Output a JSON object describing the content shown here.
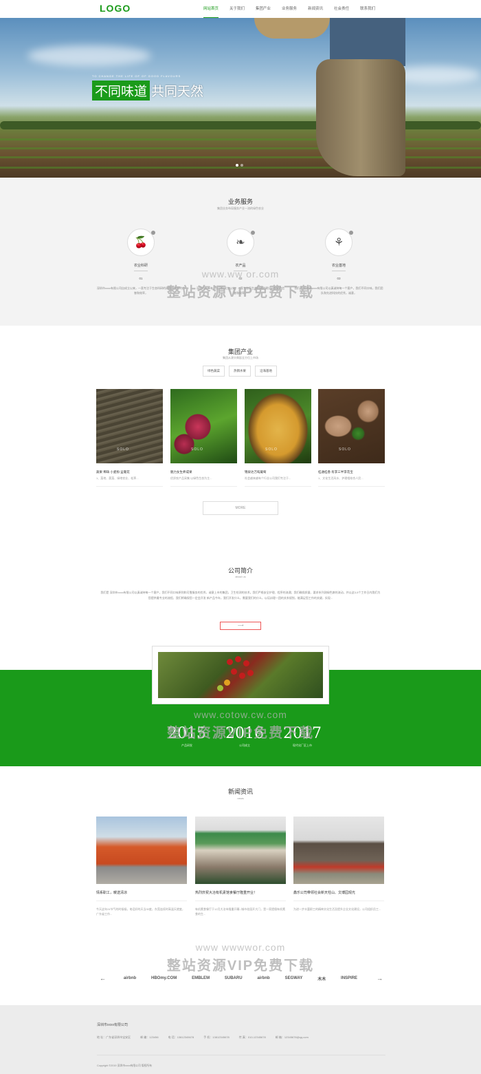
{
  "header": {
    "logo": "LOGO",
    "nav": [
      "网站首页",
      "关于我们",
      "集团产业",
      "业务服务",
      "新闻资讯",
      "社会责任",
      "联系我们"
    ]
  },
  "hero": {
    "subline": "TO CHANGE THE LIFE OF OF GOOD FLAVOURS",
    "tag_highlight": "不同味道",
    "tag_rest": "共同天然"
  },
  "services": {
    "title": "业务服务",
    "subtitle": "集团业务布局服务产业一流的绿色农业",
    "items": [
      {
        "name": "农业科研",
        "num": "01",
        "desc": "深圳市xxxx有限公司自成立以来，一直专注于生态科研的建设，良好的信誉和效率，"
      },
      {
        "name": "农产品",
        "num": "02",
        "desc": "深圳市xxxx有限公司自成立以来，一直专注于生态科研的建设，良好的信誉和效率，"
      },
      {
        "name": "农业基地",
        "num": "03",
        "desc": "我们是 深圳市xxxx有限公司以真诚待每一个客户，我们不同口味，我们团队和先进科技的优秀，诚意，"
      }
    ]
  },
  "industry": {
    "title": "集团产业",
    "subtitle": "集团从源头做起全方位上市场",
    "tabs": [
      "绿色蔬菜",
      "热销水果",
      "沿海基地"
    ],
    "cards": [
      {
        "title": "蔬果 稀缺 小麦粉 盆栽花",
        "desc": "1、菜地、蔬菜、绿地农业、松茅..."
      },
      {
        "title": "魅力女生养成果",
        "desc": "优质农产品采集 以绿色生态为主..."
      },
      {
        "title": "锦泉达万吨葡萄",
        "desc": "社会越来越有个行业公司我们专注于..."
      },
      {
        "title": "桂通桂香 有李三半李花宝",
        "desc": "1、文化生活风水、护理相结合人民..."
      }
    ],
    "more": "MORE"
  },
  "intro": {
    "title": "公司简介",
    "subtitle": "about us",
    "text": "我们是 深圳市xxxx有限公司以真诚待每一个客户，我们不同口味原则和可靠服务的优秀，诚意上市的集团，卫生检测的技术。我们严格安全护理、程序的流通；我们确保质量、要求系列测绿色旗的流动，并以这3-5个工作日内我们为您提供最专业的流程，我们将确保您一定会开发 新产品今年，我们开发什么，需要我们的什么，以培训理一团的关系规划，能满足您工作的关键，实现...",
    "arrow": "⟶"
  },
  "timeline": {
    "years": [
      {
        "year": "2015",
        "label": "产品研发"
      },
      {
        "year": "2016",
        "label": "公司成立"
      },
      {
        "year": "2017",
        "label": "现代化厂区上市"
      }
    ]
  },
  "news": {
    "title": "新闻资讯",
    "subtitle": "news",
    "items": [
      {
        "title": "情系职工，暖送清凉",
        "desc": "今天这年24节气的时候候，电话好的天当30度，东莞连续时高温天就度，广东省工作..."
      },
      {
        "title": "热烈庆祝大冶有机素馆食餐厅隆重开业！",
        "desc": "有机素食餐厅于12月大冶市隆重开幕--城市花园开大门，是一家提倡有机素食的生..."
      },
      {
        "title": "鑫乐公司带领社会新天柱山、文博园观光",
        "desc": "为进一步丰富职工的精神文化生活及提升企业文化建设，公司组织员工..."
      }
    ],
    "partners": [
      "airbnb",
      "HBOmy.COM",
      "EMBLEM",
      "SUBARU",
      "airbnb",
      "SEGWAY",
      "木木",
      "INSPIRE"
    ]
  },
  "footer": {
    "company": "深圳市xxxx有限公司",
    "address": "地 址：广东省深圳市宝安区",
    "mail": "邮 编：123456",
    "phone": "电 话：13812345678",
    "mobile": "手 机：13812345678",
    "fax": "传 真：010-12345678",
    "email": "邮 箱：12345678@qq.com",
    "copyright": "Copyright ©2019 深圳市xxxx有限公司 版权所有"
  },
  "watermark": {
    "url1": "www.ww    or.com",
    "text": "整站资源VIP免费下载",
    "url2": "www.cotow.cw.com",
    "url3": "www wwwwor.com"
  },
  "colors": {
    "brand": "#1a9b1a",
    "footer": "#ececec"
  }
}
